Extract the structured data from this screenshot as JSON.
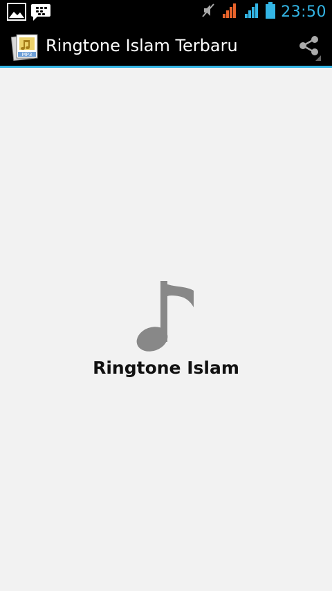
{
  "status_bar": {
    "time": "23:50",
    "left_icons": [
      "image-notification-icon",
      "bbm-notification-icon"
    ],
    "right_icons": [
      "silent-mode-icon",
      "signal-1-icon",
      "signal-2-icon",
      "battery-icon"
    ],
    "signal_1_color": "#e8632b",
    "signal_2_color": "#33b5e5",
    "battery_color": "#33b5e5"
  },
  "action_bar": {
    "title": "Ringtone Islam Terbaru",
    "app_icon": "mp3-file-icon",
    "share_icon": "share-icon",
    "accent_color": "#33b5e5"
  },
  "main": {
    "icon": "music-note-icon",
    "title": "Ringtone Islam"
  }
}
